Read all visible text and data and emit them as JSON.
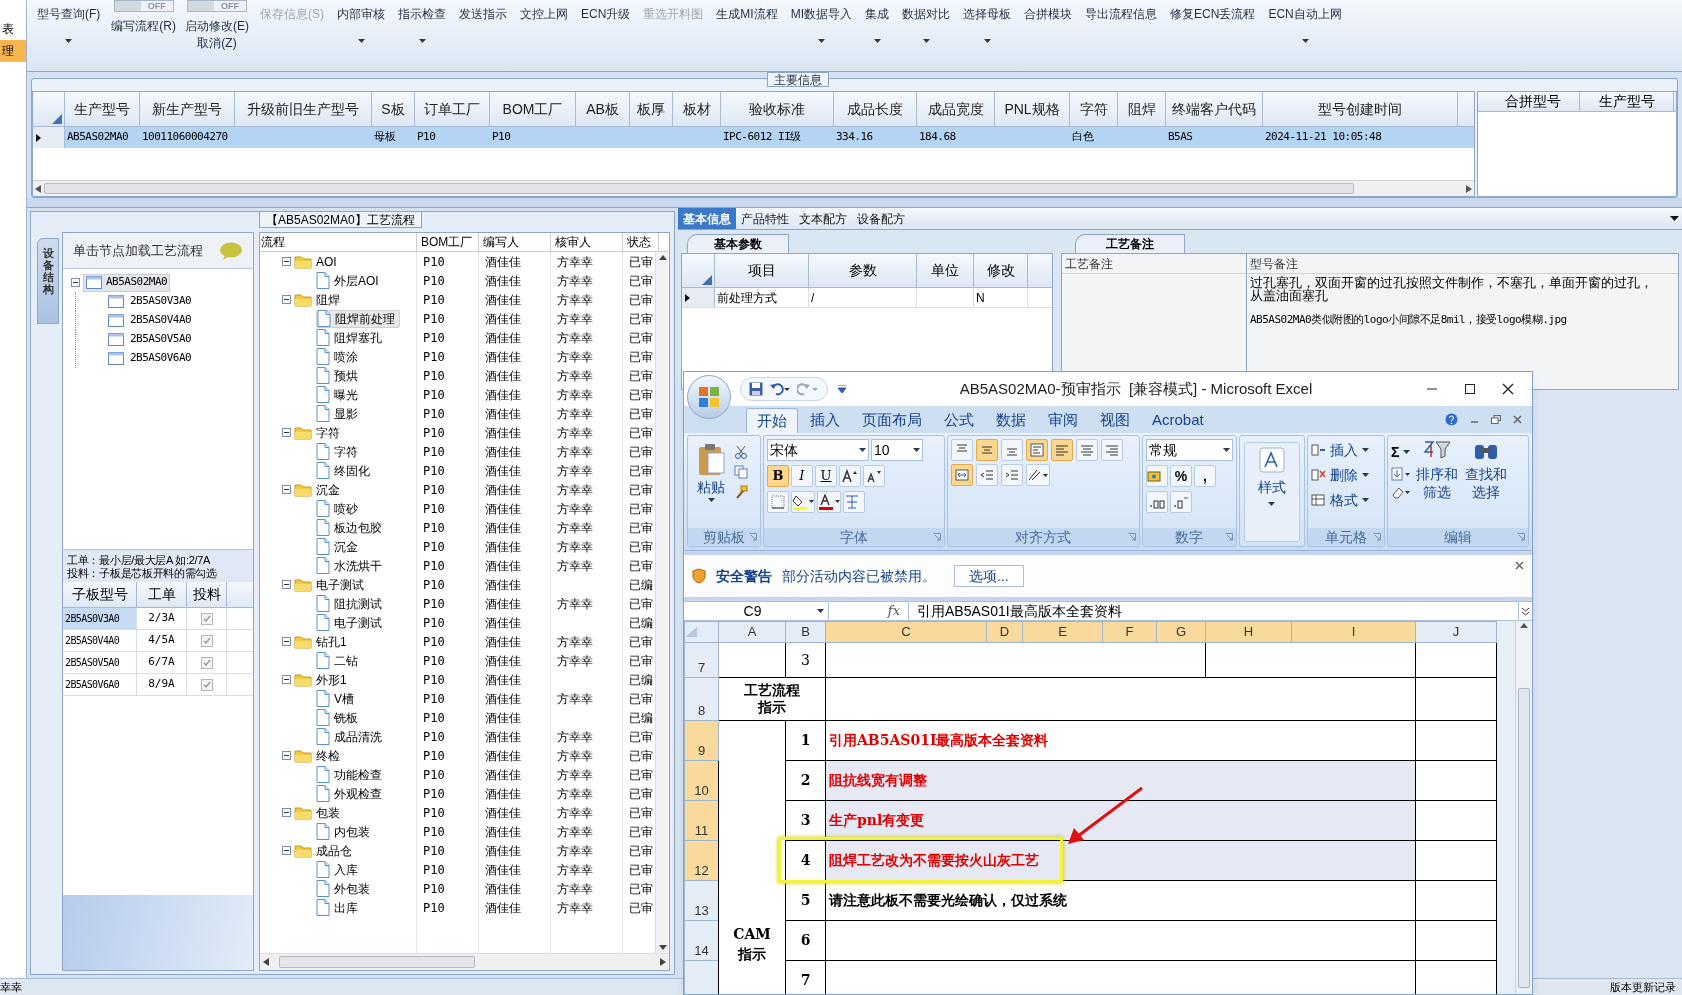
{
  "left_nav": [
    {
      "label": "表",
      "selected": false
    },
    {
      "label": "理",
      "selected": true
    }
  ],
  "toolbar": {
    "items": [
      {
        "kind": "dropdown",
        "label": "型号查询(F)",
        "disabled": false
      },
      {
        "kind": "toggle",
        "label": "编写流程(R)",
        "toggle_text": "OFF",
        "on": false
      },
      {
        "kind": "toggle",
        "label": "启动修改(E)\n取消(Z)",
        "toggle_text": "OFF",
        "on": false
      },
      {
        "kind": "button",
        "label": "保存信息(S)",
        "disabled": true
      },
      {
        "kind": "dropdown",
        "label": "内部审核",
        "disabled": false
      },
      {
        "kind": "dropdown",
        "label": "指示检查",
        "disabled": false
      },
      {
        "kind": "button",
        "label": "发送指示",
        "disabled": false
      },
      {
        "kind": "button",
        "label": "文控上网",
        "disabled": false
      },
      {
        "kind": "button",
        "label": "ECN升级",
        "disabled": false
      },
      {
        "kind": "button",
        "label": "重选开料图",
        "disabled": true
      },
      {
        "kind": "button",
        "label": "生成MI流程",
        "disabled": false
      },
      {
        "kind": "dropdown",
        "label": "MI数据导入",
        "disabled": false
      },
      {
        "kind": "dropdown",
        "label": "集成",
        "disabled": false
      },
      {
        "kind": "dropdown",
        "label": "数据对比",
        "disabled": false
      },
      {
        "kind": "dropdown",
        "label": "选择母板",
        "disabled": false
      },
      {
        "kind": "button",
        "label": "合拼模块",
        "disabled": false
      },
      {
        "kind": "button",
        "label": "导出流程信息",
        "disabled": false
      },
      {
        "kind": "button",
        "label": "修复ECN丢流程",
        "disabled": false
      },
      {
        "kind": "dropdown",
        "label": "ECN自动上网",
        "disabled": false
      }
    ]
  },
  "main_info": {
    "title": "主要信息",
    "columns": [
      "生产型号",
      "新生产型号",
      "升级前旧生产型号",
      "S板",
      "订单工厂",
      "BOM工厂",
      "AB板",
      "板厚",
      "板材",
      "验收标准",
      "成品长度",
      "成品宽度",
      "PNL规格",
      "字符",
      "阻焊",
      "终端客户代码",
      "型号创建时间"
    ],
    "rows": [
      {
        "selected": true,
        "cells": [
          "AB5AS02MA0",
          "10011060004270",
          "",
          "母板",
          "P10",
          "P10",
          "",
          "",
          "",
          "IPC-6012 II级",
          "334.16",
          "184.68",
          "",
          "白色",
          "",
          "B5AS",
          "2024-11-21 10:05:48"
        ]
      }
    ],
    "merge_columns": [
      "合拼型号",
      "生产型号"
    ]
  },
  "process_panel": {
    "title": "【AB5AS02MA0】工艺流程",
    "side_tab": "设备结构",
    "structure": {
      "header": "单击节点加载工艺流程",
      "tree": [
        {
          "label": "AB5AS02MA0",
          "selected": true,
          "expanded": true,
          "children": [
            {
              "label": "2B5AS0V3A0",
              "selected": false
            },
            {
              "label": "2B5AS0V4A0",
              "selected": false
            },
            {
              "label": "2B5AS0V5A0",
              "selected": false
            },
            {
              "label": "2B5AS0V6A0",
              "selected": false
            }
          ]
        }
      ],
      "notes": [
        "工单：最小层/最大层A 如:2/7A",
        "投料：子板是芯板开料的需勾选"
      ],
      "columns": [
        "子板型号",
        "工单",
        "投料"
      ],
      "rows": [
        {
          "board": "2B5AS0V3A0",
          "order": "2/3A",
          "checked": true,
          "selected": true
        },
        {
          "board": "2B5AS0V4A0",
          "order": "4/5A",
          "checked": true,
          "selected": false
        },
        {
          "board": "2B5AS0V5A0",
          "order": "6/7A",
          "checked": true,
          "selected": false
        },
        {
          "board": "2B5AS0V6A0",
          "order": "8/9A",
          "checked": true,
          "selected": false
        }
      ]
    },
    "flow": {
      "columns": [
        "流程",
        "BOM工厂",
        "编写人",
        "核审人",
        "状态"
      ],
      "tree": [
        {
          "label": "AOI",
          "bom": "P10",
          "writer": "酒佳佳",
          "reviewer": "方幸幸",
          "status": "已审",
          "selected": false,
          "expanded": true,
          "children": [
            {
              "label": "外层AOI",
              "bom": "P10",
              "writer": "酒佳佳",
              "reviewer": "方幸幸",
              "status": "已审",
              "selected": false
            }
          ]
        },
        {
          "label": "阻焊",
          "bom": "P10",
          "writer": "酒佳佳",
          "reviewer": "方幸幸",
          "status": "已审",
          "selected": false,
          "expanded": true,
          "children": [
            {
              "label": "阻焊前处理",
              "bom": "P10",
              "writer": "酒佳佳",
              "reviewer": "方幸幸",
              "status": "已审",
              "selected": true
            },
            {
              "label": "阻焊塞孔",
              "bom": "P10",
              "writer": "酒佳佳",
              "reviewer": "方幸幸",
              "status": "已审",
              "selected": false
            },
            {
              "label": "喷涂",
              "bom": "P10",
              "writer": "酒佳佳",
              "reviewer": "方幸幸",
              "status": "已审",
              "selected": false
            },
            {
              "label": "预烘",
              "bom": "P10",
              "writer": "酒佳佳",
              "reviewer": "方幸幸",
              "status": "已审",
              "selected": false
            },
            {
              "label": "曝光",
              "bom": "P10",
              "writer": "酒佳佳",
              "reviewer": "方幸幸",
              "status": "已审",
              "selected": false
            },
            {
              "label": "显影",
              "bom": "P10",
              "writer": "酒佳佳",
              "reviewer": "方幸幸",
              "status": "已审",
              "selected": false
            }
          ]
        },
        {
          "label": "字符",
          "bom": "P10",
          "writer": "酒佳佳",
          "reviewer": "方幸幸",
          "status": "已审",
          "selected": false,
          "expanded": true,
          "children": [
            {
              "label": "字符",
              "bom": "P10",
              "writer": "酒佳佳",
              "reviewer": "方幸幸",
              "status": "已审",
              "selected": false
            },
            {
              "label": "终固化",
              "bom": "P10",
              "writer": "酒佳佳",
              "reviewer": "方幸幸",
              "status": "已审",
              "selected": false
            }
          ]
        },
        {
          "label": "沉金",
          "bom": "P10",
          "writer": "酒佳佳",
          "reviewer": "方幸幸",
          "status": "已审",
          "selected": false,
          "expanded": true,
          "children": [
            {
              "label": "喷砂",
              "bom": "P10",
              "writer": "酒佳佳",
              "reviewer": "方幸幸",
              "status": "已审",
              "selected": false
            },
            {
              "label": "板边包胶",
              "bom": "P10",
              "writer": "酒佳佳",
              "reviewer": "方幸幸",
              "status": "已审",
              "selected": false
            },
            {
              "label": "沉金",
              "bom": "P10",
              "writer": "酒佳佳",
              "reviewer": "方幸幸",
              "status": "已审",
              "selected": false
            },
            {
              "label": "水洗烘干",
              "bom": "P10",
              "writer": "酒佳佳",
              "reviewer": "方幸幸",
              "status": "已审",
              "selected": false
            }
          ]
        },
        {
          "label": "电子测试",
          "bom": "P10",
          "writer": "酒佳佳",
          "status": "已编",
          "selected": false,
          "expanded": true,
          "children": [
            {
              "label": "阻抗测试",
              "bom": "P10",
              "writer": "酒佳佳",
              "reviewer": "方幸幸",
              "status": "已审",
              "selected": false
            },
            {
              "label": "电子测试",
              "bom": "P10",
              "writer": "酒佳佳",
              "status": "已编",
              "selected": false
            }
          ]
        },
        {
          "label": "钻孔1",
          "bom": "P10",
          "writer": "酒佳佳",
          "reviewer": "方幸幸",
          "status": "已审",
          "selected": false,
          "expanded": true,
          "children": [
            {
              "label": "二钻",
              "bom": "P10",
              "writer": "酒佳佳",
              "reviewer": "方幸幸",
              "status": "已审",
              "selected": false
            }
          ]
        },
        {
          "label": "外形1",
          "bom": "P10",
          "writer": "酒佳佳",
          "status": "已编",
          "selected": false,
          "expanded": true,
          "children": [
            {
              "label": "V槽",
              "bom": "P10",
              "writer": "酒佳佳",
              "reviewer": "方幸幸",
              "status": "已审",
              "selected": false
            },
            {
              "label": "铣板",
              "bom": "P10",
              "writer": "酒佳佳",
              "status": "已编",
              "selected": false
            },
            {
              "label": "成品清洗",
              "bom": "P10",
              "writer": "酒佳佳",
              "reviewer": "方幸幸",
              "status": "已审",
              "selected": false
            }
          ]
        },
        {
          "label": "终检",
          "bom": "P10",
          "writer": "酒佳佳",
          "reviewer": "方幸幸",
          "status": "已审",
          "selected": false,
          "expanded": true,
          "children": [
            {
              "label": "功能检查",
              "bom": "P10",
              "writer": "酒佳佳",
              "reviewer": "方幸幸",
              "status": "已审",
              "selected": false
            },
            {
              "label": "外观检查",
              "bom": "P10",
              "writer": "酒佳佳",
              "reviewer": "方幸幸",
              "status": "已审",
              "selected": false
            }
          ]
        },
        {
          "label": "包装",
          "bom": "P10",
          "writer": "酒佳佳",
          "reviewer": "方幸幸",
          "status": "已审",
          "selected": false,
          "expanded": true,
          "children": [
            {
              "label": "内包装",
              "bom": "P10",
              "writer": "酒佳佳",
              "reviewer": "方幸幸",
              "status": "已审",
              "selected": false
            }
          ]
        },
        {
          "label": "成品仓",
          "bom": "P10",
          "writer": "酒佳佳",
          "reviewer": "方幸幸",
          "status": "已审",
          "selected": false,
          "expanded": true,
          "children": [
            {
              "label": "入库",
              "bom": "P10",
              "writer": "酒佳佳",
              "reviewer": "方幸幸",
              "status": "已审",
              "selected": false
            },
            {
              "label": "外包装",
              "bom": "P10",
              "writer": "酒佳佳",
              "reviewer": "方幸幸",
              "status": "已审",
              "selected": false
            },
            {
              "label": "出库",
              "bom": "P10",
              "writer": "酒佳佳",
              "reviewer": "方幸幸",
              "status": "已审",
              "selected": false
            }
          ]
        }
      ]
    }
  },
  "detail_panel": {
    "tabs": [
      {
        "label": "基本信息",
        "selected": true
      },
      {
        "label": "产品特性",
        "selected": false
      },
      {
        "label": "文本配方",
        "selected": false
      },
      {
        "label": "设备配方",
        "selected": false
      }
    ],
    "params": {
      "tab": "基本参数",
      "columns": [
        "项目",
        "参数",
        "单位",
        "修改"
      ],
      "rows": [
        {
          "cells": [
            "前处理方式",
            "/",
            "",
            "N"
          ]
        }
      ]
    },
    "remarks": {
      "tab": "工艺备注",
      "columns": [
        "工艺备注",
        "型号备注"
      ],
      "model_remarks": [
        "过孔塞孔，双面开窗的过孔按照文件制作，不塞孔，单面开窗的过孔，从盖油面塞孔",
        "AB5AS02MA0类似附图的logo小间隙不足8mil，接受logo模糊.jpg"
      ]
    }
  },
  "excel": {
    "title": "AB5AS02MA0-预审指示  [兼容模式] - Microsoft Excel",
    "tabs": [
      {
        "label": "开始",
        "selected": true
      },
      {
        "label": "插入",
        "selected": false
      },
      {
        "label": "页面布局",
        "selected": false
      },
      {
        "label": "公式",
        "selected": false
      },
      {
        "label": "数据",
        "selected": false
      },
      {
        "label": "审阅",
        "selected": false
      },
      {
        "label": "视图",
        "selected": false
      },
      {
        "label": "Acrobat",
        "selected": false
      }
    ],
    "ribbon": [
      {
        "kind": "clipboard",
        "label": "剪贴板",
        "paste": "粘贴"
      },
      {
        "kind": "font",
        "label": "字体",
        "font": "宋体",
        "size": "10",
        "styles": [
          {
            "text": "B",
            "selected": true
          },
          {
            "text": "I",
            "selected": false
          },
          {
            "text": "U",
            "selected": false
          }
        ]
      },
      {
        "kind": "alignment",
        "label": "对齐方式",
        "buttons": [
          {
            "selected": false
          },
          {
            "selected": true
          },
          {
            "selected": false
          },
          {
            "selected": true
          },
          {
            "selected": true
          },
          {
            "selected": false
          },
          {
            "selected": false
          },
          {
            "selected": true
          }
        ]
      },
      {
        "kind": "number",
        "label": "数字",
        "format": "常规",
        "symbols": [
          "%",
          ","
        ]
      },
      {
        "kind": "styles",
        "button": "样式"
      },
      {
        "kind": "cells",
        "label": "单元格",
        "buttons": [
          "插入",
          "删除",
          "格式"
        ]
      },
      {
        "kind": "editing",
        "label": "编辑",
        "sum": "Σ",
        "buttons": [
          "排序和筛选",
          "查找和选择"
        ]
      }
    ],
    "security": {
      "title": "安全警告",
      "message": "部分活动内容已被禁用。",
      "button": "选项..."
    },
    "formula": {
      "cell": "C9",
      "fx": "fx",
      "value": "引用AB5AS01I最高版本全套资料"
    },
    "columns": [
      {
        "label": "A",
        "selected": false
      },
      {
        "label": "B",
        "selected": false
      },
      {
        "label": "C",
        "selected": true
      },
      {
        "label": "D",
        "selected": true
      },
      {
        "label": "E",
        "selected": true
      },
      {
        "label": "F",
        "selected": true
      },
      {
        "label": "G",
        "selected": true
      },
      {
        "label": "H",
        "selected": true
      },
      {
        "label": "I",
        "selected": true
      },
      {
        "label": "J",
        "selected": false
      }
    ],
    "rows": [
      {
        "kind": "split",
        "number": "7",
        "selected": false,
        "item": "3",
        "highlighted": false
      },
      {
        "kind": "heading",
        "number": "8",
        "selected": false,
        "section": "工艺流程指示",
        "highlighted": false
      },
      {
        "kind": "item",
        "number": "9",
        "selected": true,
        "section": "CAM\n指示",
        "item": "1",
        "text": "引用AB5AS01I最高版本全套资料",
        "color": "#e00000",
        "highlighted": false
      },
      {
        "kind": "item",
        "number": "10",
        "selected": true,
        "item": "2",
        "text": "阻抗线宽有调整",
        "color": "#e00000",
        "highlighted": false
      },
      {
        "kind": "item",
        "number": "11",
        "selected": true,
        "item": "3",
        "text": "生产pnl有变更",
        "color": "#e00000",
        "highlighted": false
      },
      {
        "kind": "item",
        "number": "12",
        "selected": true,
        "item": "4",
        "text": "阻焊工艺改为不需要按火山灰工艺",
        "color": "#e00000",
        "highlighted": true
      },
      {
        "kind": "item",
        "number": "13",
        "selected": false,
        "item": "5",
        "text": "请注意此板不需要光绘确认，仅过系统",
        "color": "#000000",
        "highlighted": false
      },
      {
        "kind": "item",
        "number": "14",
        "selected": false,
        "item": "6",
        "highlighted": false
      },
      {
        "kind": "item",
        "selected": false,
        "item": "7",
        "highlighted": false
      }
    ]
  },
  "status_bar": {
    "left": "幸幸",
    "right": "版本更新记录"
  }
}
